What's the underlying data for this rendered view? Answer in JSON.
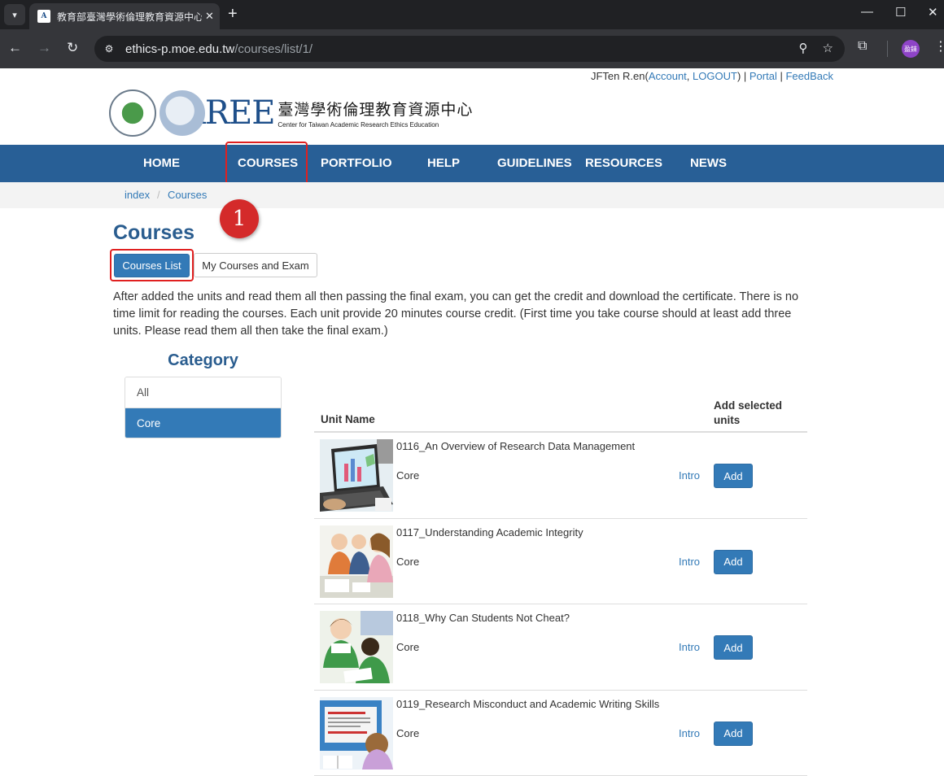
{
  "browser": {
    "tab_title": "教育部臺灣學術倫理教育資源中心",
    "url_host": "ethics-p.moe.edu.tw",
    "url_path": "/courses/list/1/",
    "avatar_text": "盈錸"
  },
  "header": {
    "user": "JFTen R.en",
    "account_label": "Account",
    "logout_label": "LOGOUT",
    "portal_label": "Portal",
    "feedback_label": "FeedBack",
    "logo_word": "AREE",
    "logo_cn": "臺灣學術倫理教育資源中心",
    "logo_en": "Center for Taiwan Academic Research Ethics Education"
  },
  "nav": {
    "items": [
      "HOME",
      "COURSES",
      "PORTFOLIO",
      "HELP",
      "GUIDELINES",
      "RESOURCES",
      "NEWS"
    ]
  },
  "breadcrumb": {
    "items": [
      "index",
      "Courses"
    ]
  },
  "annotation": {
    "step": "1"
  },
  "main": {
    "title": "Courses",
    "tab_courses_list": "Courses List",
    "tab_my_courses": "My Courses and Exam",
    "intro": "After added the units and read them all then passing the final exam, you can get the credit and download the certificate. There is no time limit for reading the courses. Each unit provide 20 minutes course credit. (First time you take course should at least add three units. Please read them all then take the final exam.)"
  },
  "category": {
    "heading": "Category",
    "items": [
      "All",
      "Core"
    ],
    "active": "Core"
  },
  "table": {
    "col_unit_name": "Unit Name",
    "col_add": "Add selected units",
    "rows": [
      {
        "name": "0116_An Overview of Research Data Management",
        "category": "Core",
        "intro": "Intro",
        "add": "Add",
        "thumb": "laptop-chart-thumbnail"
      },
      {
        "name": "0117_Understanding Academic Integrity",
        "category": "Core",
        "intro": "Intro",
        "add": "Add",
        "thumb": "meeting-people-thumbnail"
      },
      {
        "name": "0118_Why Can Students Not Cheat?",
        "category": "Core",
        "intro": "Intro",
        "add": "Add",
        "thumb": "students-writing-thumbnail"
      },
      {
        "name": "0119_Research Misconduct and Academic Writing Skills",
        "category": "Core",
        "intro": "Intro",
        "add": "Add",
        "thumb": "student-reading-screen-thumbnail"
      }
    ]
  },
  "colors": {
    "navbar": "#285f96",
    "primary": "#337ab7",
    "title": "#2a5d8f",
    "highlight": "#e02020",
    "badge": "#d42a2a"
  }
}
